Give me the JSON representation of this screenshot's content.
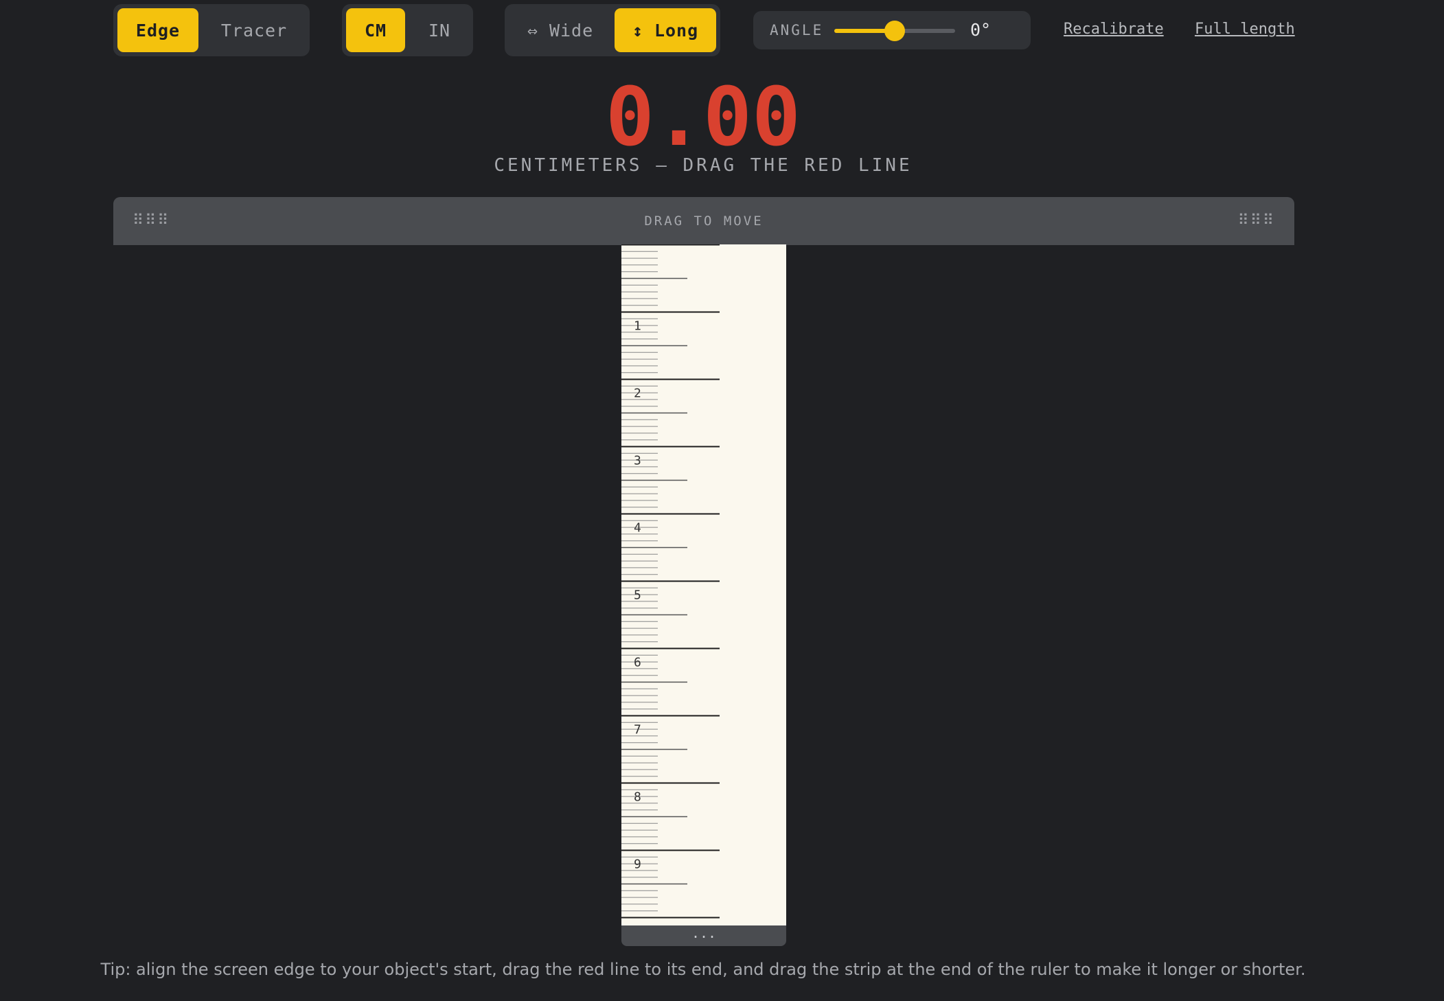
{
  "mode": {
    "options": [
      "Edge",
      "Tracer"
    ],
    "selected": "Edge"
  },
  "units": {
    "options": [
      "CM",
      "IN"
    ],
    "selected": "CM"
  },
  "orientation": {
    "wide_label": "⇔ Wide",
    "long_label": "↕ Long",
    "selected": "Long"
  },
  "angle": {
    "label": "ANGLE",
    "value_text": "0°",
    "slider_fraction": 0.5
  },
  "links": {
    "recalibrate": "Recalibrate",
    "full_length": "Full length"
  },
  "reading": {
    "value": "0.00",
    "caption": "CENTIMETERS — DRAG THE RED LINE"
  },
  "drag_handle": {
    "label": "DRAG TO MOVE",
    "grip_glyph": "⠿⠿⠿"
  },
  "ruler": {
    "unit": "cm",
    "labels": [
      "1",
      "2",
      "3",
      "4",
      "5",
      "6",
      "7",
      "8",
      "9"
    ],
    "end_glyph": "..."
  },
  "tip": "Tip: align the screen edge to your object's start, drag the red line to its end, and drag the strip at the end of the ruler to make it longer or shorter.",
  "colors": {
    "accent": "#f4c20d",
    "reading": "#d9412f",
    "background": "#1f2023",
    "ruler": "#fbf8ee"
  }
}
